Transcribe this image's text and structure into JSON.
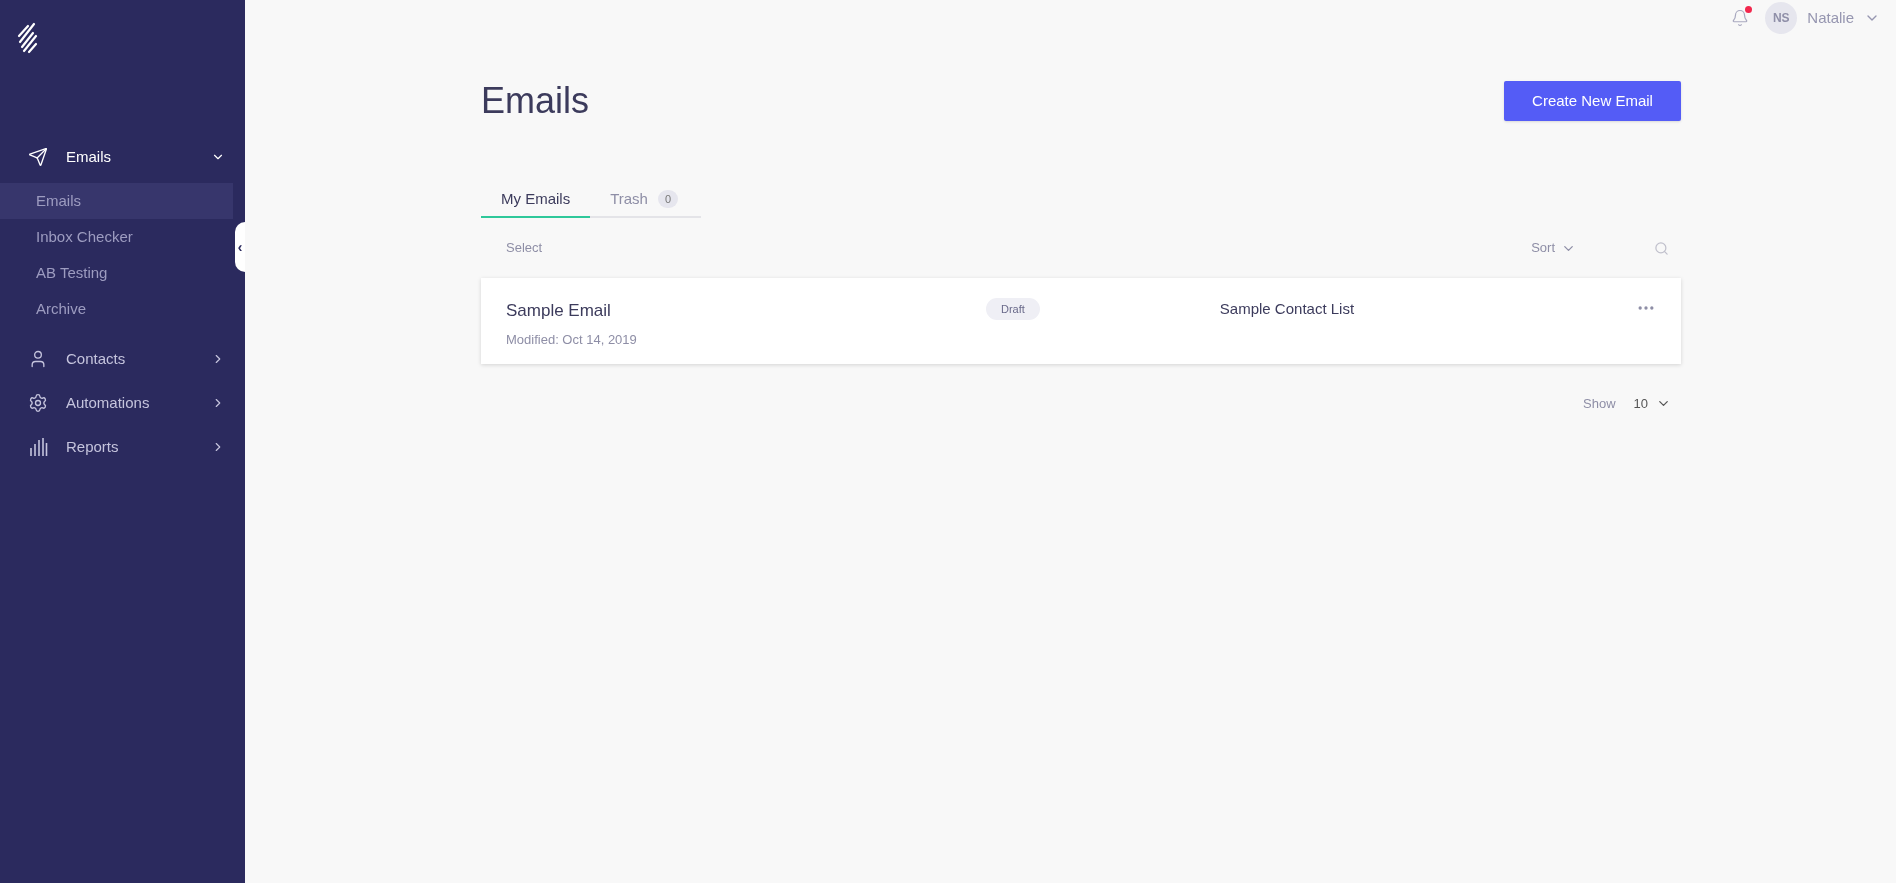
{
  "sidebar": {
    "collapse_handle": "‹",
    "items": [
      {
        "label": "Emails",
        "expanded": true,
        "children": [
          {
            "label": "Emails",
            "selected": true
          },
          {
            "label": "Inbox Checker",
            "selected": false
          },
          {
            "label": "AB Testing",
            "selected": false
          },
          {
            "label": "Archive",
            "selected": false
          }
        ]
      },
      {
        "label": "Contacts",
        "expanded": false
      },
      {
        "label": "Automations",
        "expanded": false
      },
      {
        "label": "Reports",
        "expanded": false
      }
    ]
  },
  "header": {
    "notifications": {
      "unread": true
    },
    "user": {
      "initials": "NS",
      "name": "Natalie"
    }
  },
  "page": {
    "title": "Emails",
    "create_button": "Create New Email"
  },
  "tabs": [
    {
      "label": "My Emails",
      "selected": true
    },
    {
      "label": "Trash",
      "count": "0",
      "selected": false
    }
  ],
  "toolbar": {
    "select": "Select",
    "sort": "Sort"
  },
  "emails": [
    {
      "name": "Sample Email",
      "modified": "Modified: Oct 14, 2019",
      "status": "Draft",
      "list": "Sample Contact List"
    }
  ],
  "pagination": {
    "show_label": "Show",
    "page_size": "10"
  }
}
